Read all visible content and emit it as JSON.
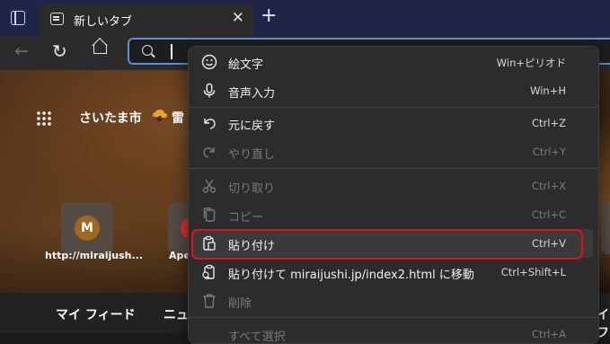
{
  "tab": {
    "title": "新しいタブ",
    "close": "✕"
  },
  "new_tab_symbol": "+",
  "toolbar": {
    "back": "←",
    "refresh": "↻"
  },
  "page": {
    "city": "さいたま市",
    "weather": "雷",
    "tiles": [
      {
        "letter": "M",
        "label": "http://miraijush..."
      },
      {
        "label": "Ape"
      }
    ],
    "feed": {
      "mine": "マイ フィード",
      "news": "ニュ",
      "right": "イフ"
    }
  },
  "menu": {
    "items": [
      {
        "label": "絵文字",
        "shortcut": "Win+ピリオド",
        "icon": "emoji-icon"
      },
      {
        "label": "音声入力",
        "shortcut": "Win+H",
        "icon": "microphone-icon"
      },
      {
        "label": "元に戻す",
        "shortcut": "Ctrl+Z",
        "icon": "undo-icon"
      },
      {
        "label": "やり直し",
        "shortcut": "Ctrl+Y",
        "icon": "redo-icon",
        "disabled": true
      },
      {
        "label": "切り取り",
        "shortcut": "Ctrl+X",
        "icon": "scissors-icon",
        "disabled": true
      },
      {
        "label": "コピー",
        "shortcut": "Ctrl+C",
        "icon": "copy-icon",
        "disabled": true
      },
      {
        "label": "貼り付け",
        "shortcut": "Ctrl+V",
        "icon": "paste-icon",
        "highlighted": true
      },
      {
        "label": "貼り付けて miraijushi.jp/index2.html に移動",
        "shortcut": "Ctrl+Shift+L",
        "icon": "paste-go-icon"
      },
      {
        "label": "削除",
        "shortcut": "",
        "icon": "trash-icon",
        "disabled": true
      },
      {
        "label": "すべて選択",
        "shortcut": "Ctrl+A",
        "icon": "",
        "disabled": true
      }
    ]
  },
  "colors": {
    "highlight_border": "#e0111b",
    "address_border": "#5b8fd6"
  }
}
